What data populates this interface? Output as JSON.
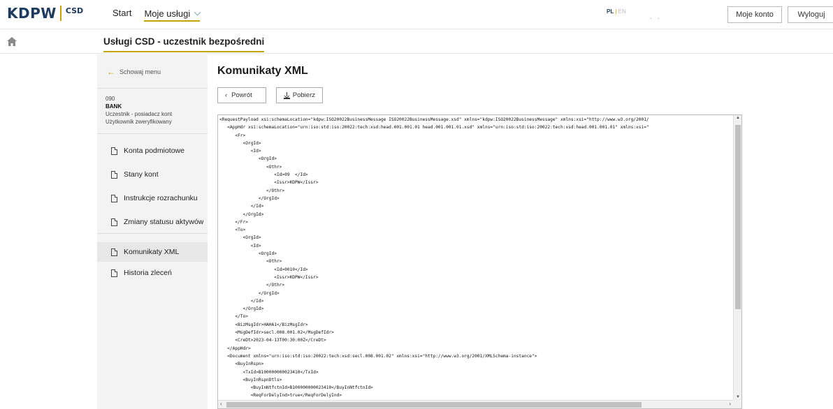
{
  "header": {
    "logo_text": "KDPW",
    "logo_sub": "CSD",
    "nav": [
      {
        "label": "Start"
      },
      {
        "label": "Moje usługi"
      }
    ],
    "lang_pl": "PL",
    "lang_sep": "|",
    "lang_en": "EN",
    "account_label": "Moje konto",
    "logout_label": "Wyloguj"
  },
  "subheader": {
    "title": "Usługi CSD - uczestnik bezpośredni"
  },
  "sidebar": {
    "hide_menu": "Schowaj menu",
    "user": {
      "code": "090",
      "name": "BANK",
      "role": "Uczestnik - posiadacz kont",
      "status": "Użytkownik zweryfikowany"
    },
    "items": [
      {
        "label": "Konta podmiotowe"
      },
      {
        "label": "Stany kont"
      },
      {
        "label": "Instrukcje rozrachunku"
      },
      {
        "label": "Zmiany statusu aktywów"
      },
      {
        "label": "Komunikaty XML"
      },
      {
        "label": "Historia zleceń"
      }
    ]
  },
  "main": {
    "title": "Komunikaty XML",
    "back_label": "Powrót",
    "download_label": "Pobierz",
    "xml_lines": [
      "<RequestPayload xsi:schemaLocation=\"kdpw:ISO20022BusinessMessage ISO20022BusinessMessage.xsd\" xmlns=\"kdpw:ISO20022BusinessMessage\" xmlns:xsi=\"http://www.w3.org/2001/",
      "   <AppHdr xsi:schemaLocation=\"urn:iso:std:iso:20022:tech:xsd:head.001.001.01 head.001.001.01.xsd\" xmlns=\"urn:iso:std:iso:20022:tech:xsd:head.001.001.01\" xmlns:xsi=\"",
      "      <Fr>",
      "         <OrgId>",
      "            <Id>",
      "               <OrgId>",
      "                  <Othr>",
      "                     <Id>09  </Id>",
      "                     <Issr>KDPW</Issr>",
      "                  </Othr>",
      "               </OrgId>",
      "            </Id>",
      "         </OrgId>",
      "      </Fr>",
      "      <To>",
      "         <OrgId>",
      "            <Id>",
      "               <OrgId>",
      "                  <Othr>",
      "                     <Id>0010</Id>",
      "                     <Issr>KDPW</Issr>",
      "                  </Othr>",
      "               </OrgId>",
      "            </Id>",
      "         </OrgId>",
      "      </To>",
      "      <BizMsgIdr>HAHA1</BizMsgIdr>",
      "      <MsgDefIdr>secl.008.001.02</MsgDefIdr>",
      "      <CreDt>2023-04-13T00:30:00Z</CreDt>",
      "   </AppHdr>",
      "   <Document xmlns=\"urn:iso:std:iso:20022:tech:xsd:secl.008.001.02\" xmlns:xsi=\"http://www.w3.org/2001/XMLSchema-instance\">",
      "      <BuyInRspn>",
      "         <TxId>B100000000023410</TxId>",
      "         <BuyInRspnDtls>",
      "            <BuyInNtfctnId>B100000000023410</BuyInNtfctnId>",
      "            <ReqForDelyInd>true</ReqForDelyInd>"
    ]
  }
}
